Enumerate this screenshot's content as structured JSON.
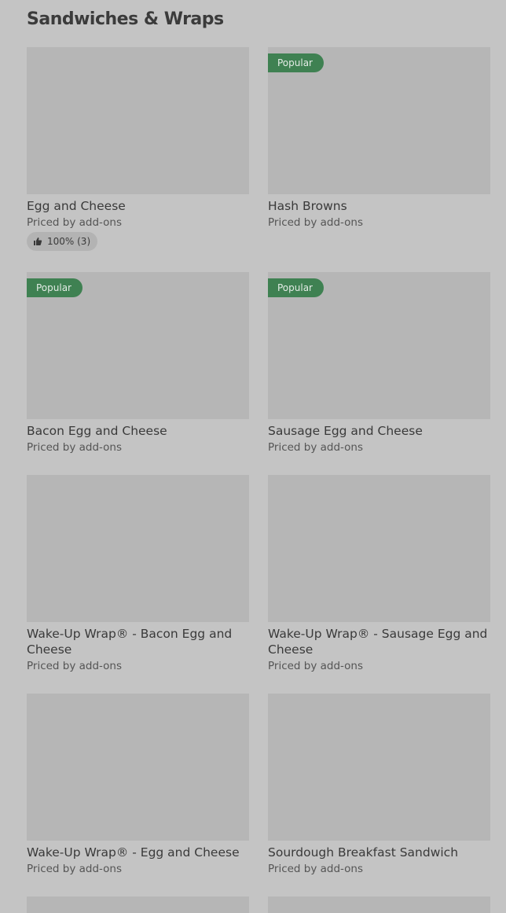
{
  "section": {
    "title": "Sandwiches & Wraps"
  },
  "items": [
    {
      "name": "Egg and Cheese",
      "price": "Priced by add-ons",
      "badge": "",
      "rating": "100% (3)"
    },
    {
      "name": "Hash Browns",
      "price": "Priced by add-ons",
      "badge": "Popular",
      "rating": ""
    },
    {
      "name": "Bacon Egg and Cheese",
      "price": "Priced by add-ons",
      "badge": "Popular",
      "rating": ""
    },
    {
      "name": "Sausage Egg and Cheese",
      "price": "Priced by add-ons",
      "badge": "Popular",
      "rating": ""
    },
    {
      "name": "Wake-Up Wrap® - Bacon Egg and Cheese",
      "price": "Priced by add-ons",
      "badge": "",
      "rating": ""
    },
    {
      "name": "Wake-Up Wrap® - Sausage Egg and Cheese",
      "price": "Priced by add-ons",
      "badge": "",
      "rating": ""
    },
    {
      "name": "Wake-Up Wrap® - Egg and Cheese",
      "price": "Priced by add-ons",
      "badge": "",
      "rating": ""
    },
    {
      "name": "Sourdough Breakfast Sandwich",
      "price": "Priced by add-ons",
      "badge": "",
      "rating": ""
    },
    {
      "name": "",
      "price": "",
      "badge": "",
      "rating": ""
    },
    {
      "name": "",
      "price": "",
      "badge": "",
      "rating": ""
    }
  ],
  "colors": {
    "background": "#c4c4c4",
    "image_placeholder": "#b6b6b6",
    "badge": "#3f8152"
  },
  "icons": {
    "rating": "thumbs-up-icon"
  }
}
